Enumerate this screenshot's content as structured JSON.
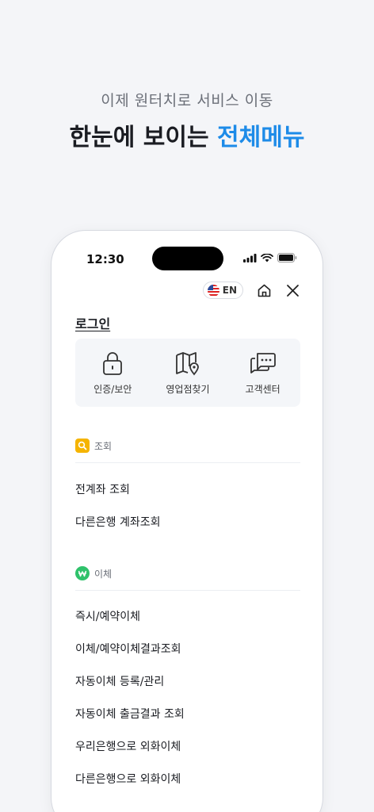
{
  "promo": {
    "subtitle": "이제 원터치로 서비스 이동",
    "title_prefix": "한눈에 보이는 ",
    "title_accent": "전체메뉴"
  },
  "status_bar": {
    "time": "12:30"
  },
  "top_actions": {
    "language_label": "EN"
  },
  "login_label": "로그인",
  "quick_menu": [
    {
      "label": "인증/보안",
      "icon": "lock-icon"
    },
    {
      "label": "영업점찾기",
      "icon": "map-pin-icon"
    },
    {
      "label": "고객센터",
      "icon": "chat-bubbles-icon"
    }
  ],
  "sections": [
    {
      "title": "조회",
      "icon": "search-icon",
      "icon_color": "#f5b400",
      "items": [
        "전계좌 조회",
        "다른은행 계좌조회"
      ]
    },
    {
      "title": "이체",
      "icon": "won-icon",
      "icon_color": "#2fc26b",
      "items": [
        "즉시/예약이체",
        "이체/예약이체결과조회",
        "자동이체 등록/관리",
        "자동이체 출금결과 조회",
        "우리은행으로 외화이체",
        "다른은행으로 외화이체"
      ]
    }
  ],
  "colors": {
    "accent": "#1d8be8",
    "background": "#f4f5f8"
  }
}
